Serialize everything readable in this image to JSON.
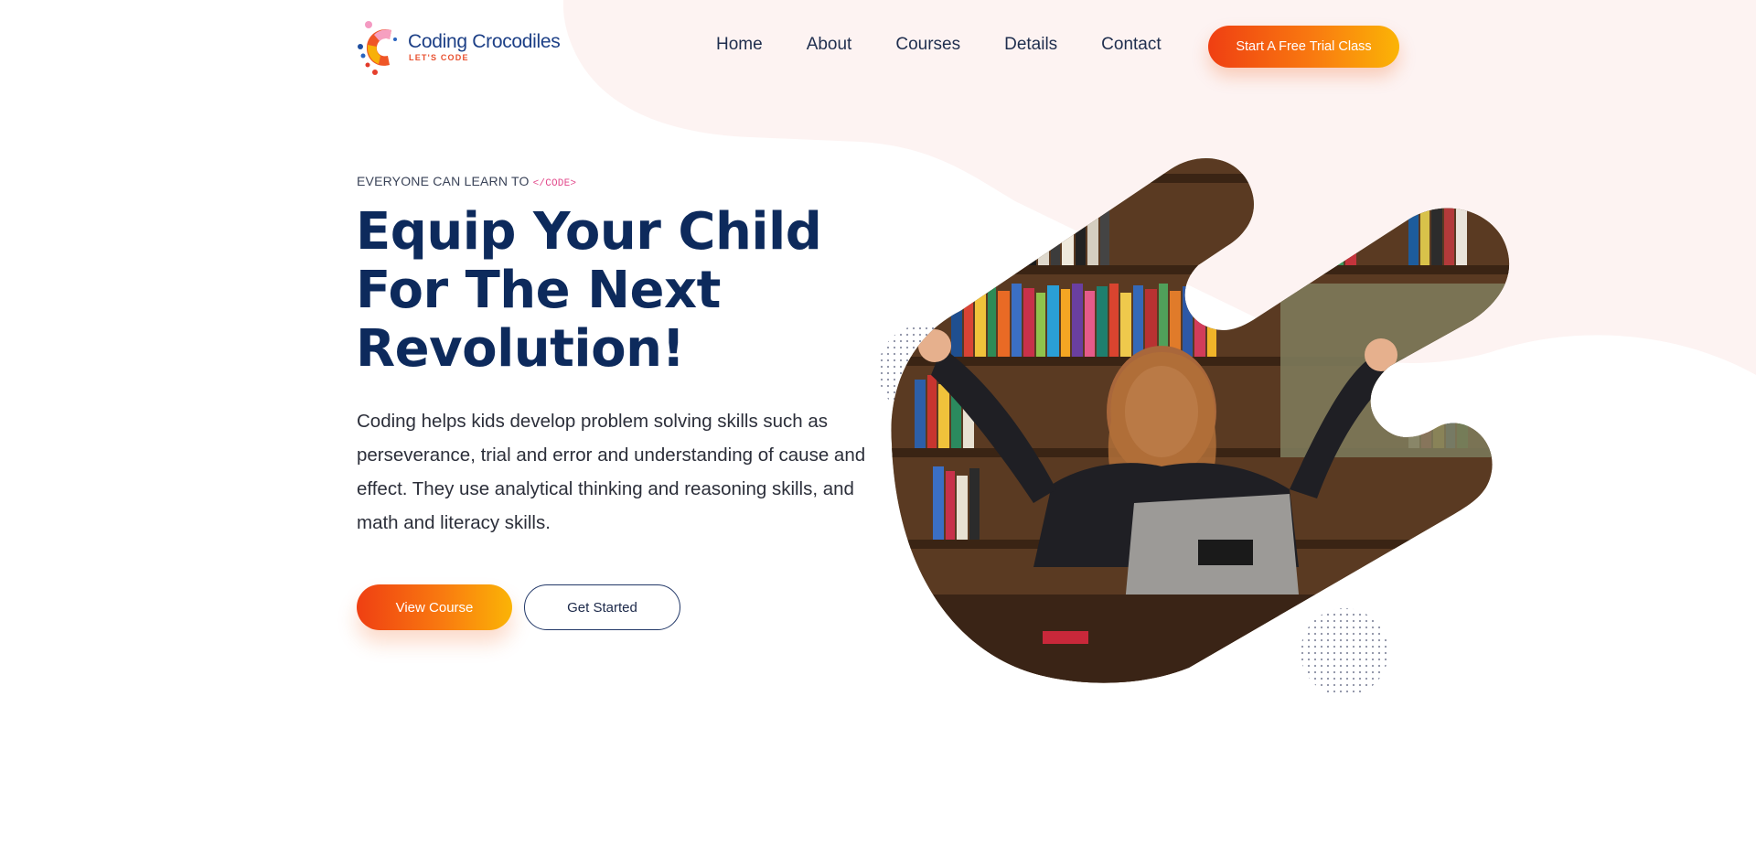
{
  "header": {
    "logo": {
      "name": "Coding Crocodiles",
      "tagline": "LET'S CODE",
      "icon": "crocodile-c-logo-icon"
    },
    "nav": [
      "Home",
      "About",
      "Courses",
      "Details",
      "Contact"
    ],
    "cta_label": "Start A Free Trial Class"
  },
  "hero": {
    "eyebrow": "EVERYONE CAN LEARN TO",
    "eyebrow_code": "</CODE>",
    "headline": [
      "Equip Your Child",
      "For The Next",
      "Revolution!"
    ],
    "description": "Coding helps kids develop problem solving skills such as perseverance, trial and error and understanding of cause and effect. They use analytical thinking and reasoning skills, and math and literacy skills.",
    "primary_button": "View Course",
    "secondary_button": "Get Started",
    "image": "girl-cheering-at-laptop-photo"
  },
  "colors": {
    "brand_navy": "#0d2a5c",
    "accent_gradient_start": "#ef3f12",
    "accent_gradient_end": "#fbb406",
    "code_pink": "#e2498b",
    "blob_bg": "#fdf3f2"
  }
}
